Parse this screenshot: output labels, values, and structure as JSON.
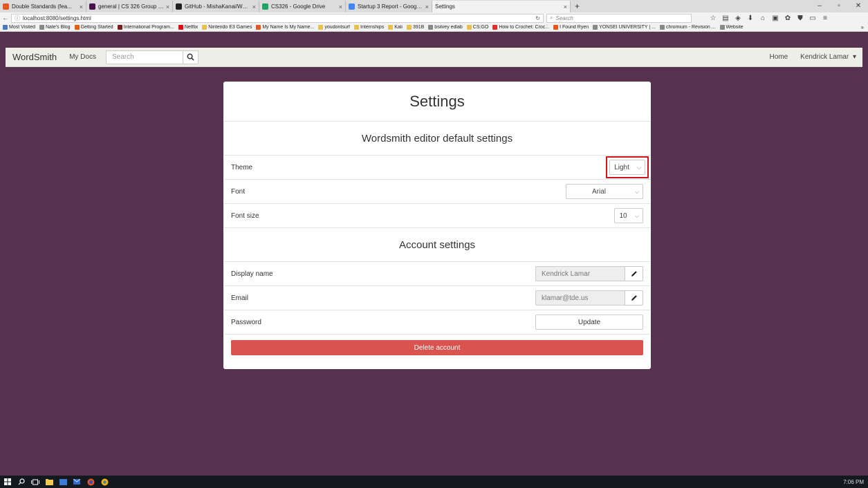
{
  "browser": {
    "tabs": [
      {
        "title": "Double Standards (fea...",
        "color": "#e8561f"
      },
      {
        "title": "general | CS 326 Group Sla...",
        "color": "#4a154b"
      },
      {
        "title": "GitHub - MishaKanai/Wor...",
        "color": "#222222"
      },
      {
        "title": "CS326 - Google Drive",
        "color": "#1fa463"
      },
      {
        "title": "Startup 3 Report - Google ...",
        "color": "#4285f4"
      },
      {
        "title": "Settings",
        "color": ""
      }
    ],
    "new_tab": "+",
    "url": "localhost:8080/settings.html",
    "search_placeholder": "Search",
    "bookmarks": [
      {
        "label": "Most Visited",
        "color": "#4a77c4"
      },
      {
        "label": "Nate's Blog",
        "color": "#888888"
      },
      {
        "label": "Getting Started",
        "color": "#e66000"
      },
      {
        "label": "International Program...",
        "color": "#7a1e1e"
      },
      {
        "label": "Netflix",
        "color": "#e50914"
      },
      {
        "label": "Nintendo E3 Games",
        "color": "#e8c14a"
      },
      {
        "label": "My Name Is My Name...",
        "color": "#e8561f"
      },
      {
        "label": "youdontsurf",
        "color": "#e8c14a"
      },
      {
        "label": "Internships",
        "color": "#e8c14a"
      },
      {
        "label": "Kali",
        "color": "#e8c14a"
      },
      {
        "label": "391B",
        "color": "#e8c14a"
      },
      {
        "label": "bsilvey edlab",
        "color": "#888888"
      },
      {
        "label": "CS:GO",
        "color": "#e8c14a"
      },
      {
        "label": "How to Crochet: Croc...",
        "color": "#e52d27"
      },
      {
        "label": "I Found Ryen",
        "color": "#e8561f"
      },
      {
        "label": "YONSEI UNIVERSITY | ...",
        "color": "#888888"
      },
      {
        "label": "chromium - Revision ...",
        "color": "#888888"
      },
      {
        "label": "Website",
        "color": "#888888"
      }
    ],
    "bookmarks_more": "»"
  },
  "app": {
    "brand": "WordSmith",
    "my_docs": "My Docs",
    "search_placeholder": "Search",
    "home": "Home",
    "user": "Kendrick Lamar",
    "user_caret": "▾"
  },
  "settings": {
    "title": "Settings",
    "editor_section": "Wordsmith editor default settings",
    "theme_label": "Theme",
    "theme_value": "Light",
    "font_label": "Font",
    "font_value": "Arial",
    "fontsize_label": "Font size",
    "fontsize_value": "10",
    "account_section": "Account settings",
    "display_name_label": "Display name",
    "display_name_value": "Kendrick Lamar",
    "email_label": "Email",
    "email_value": "klamar@tde.us",
    "password_label": "Password",
    "update_label": "Update",
    "delete_label": "Delete account"
  },
  "taskbar": {
    "clock": "7:06 PM"
  },
  "colors": {
    "page_bg": "#56324f",
    "navbar_bg": "#edeee5",
    "danger": "#d9534f",
    "highlight": "#d0121b"
  }
}
